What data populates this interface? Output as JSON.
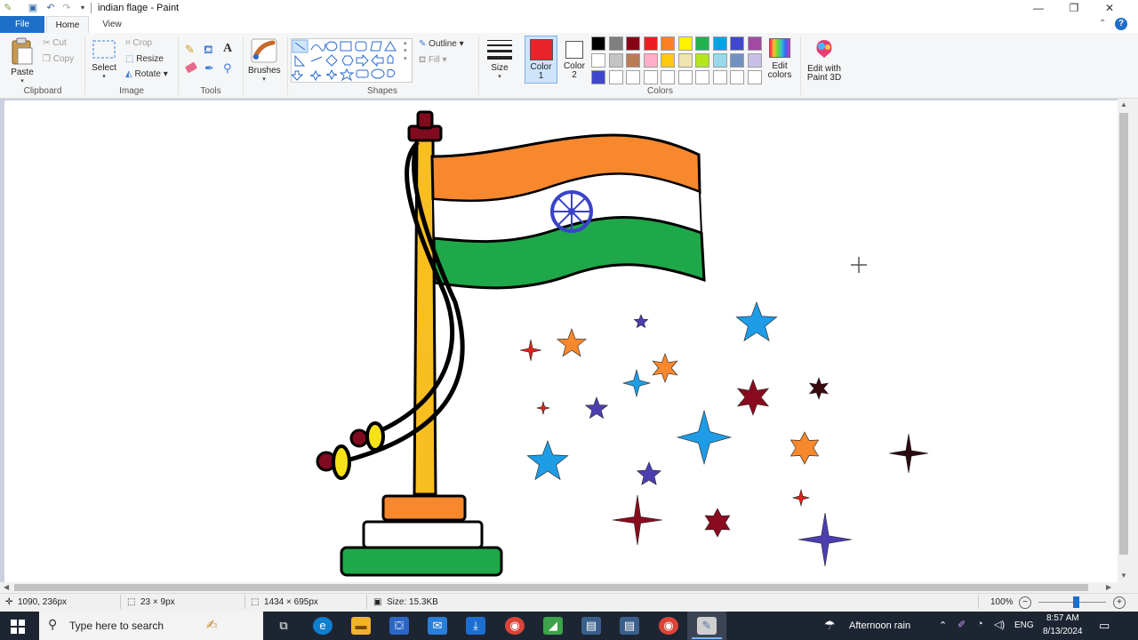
{
  "window": {
    "title": "indian flage - Paint",
    "minimize_glyph": "—",
    "restore_glyph": "❐",
    "close_glyph": "✕",
    "collapse_ribbon_glyph": "⌃",
    "help_glyph": "?"
  },
  "tabs": {
    "file": "File",
    "home": "Home",
    "view": "View"
  },
  "ribbon": {
    "clipboard": {
      "paste": "Paste",
      "cut": "Cut",
      "copy": "Copy",
      "group": "Clipboard"
    },
    "image": {
      "select": "Select",
      "crop": "Crop",
      "resize": "Resize",
      "rotate": "Rotate",
      "group": "Image"
    },
    "tools": {
      "group": "Tools"
    },
    "brushes": {
      "label": "Brushes"
    },
    "shapes": {
      "outline": "Outline",
      "fill": "Fill",
      "group": "Shapes"
    },
    "size": {
      "label": "Size"
    },
    "color1": {
      "label": "Color",
      "num": "1",
      "value": "#e8242a"
    },
    "color2": {
      "label": "Color",
      "num": "2",
      "value": "#ffffff"
    },
    "colors": {
      "group": "Colors"
    },
    "edit_colors": {
      "line1": "Edit",
      "line2": "colors"
    },
    "paint3d": {
      "line1": "Edit with",
      "line2": "Paint 3D"
    },
    "palette": {
      "row1": [
        "#000000",
        "#7f7f7f",
        "#880015",
        "#ed1c24",
        "#ff7f27",
        "#fff200",
        "#22b14c",
        "#00a2e8",
        "#3f48cc",
        "#a349a4"
      ],
      "row2": [
        "#ffffff",
        "#c3c3c3",
        "#b97a57",
        "#ffaec9",
        "#ffc90e",
        "#efe4b0",
        "#b5e61d",
        "#99d9ea",
        "#7092be",
        "#c8bfe7"
      ],
      "row3": [
        "#3f48cc",
        "#ffffff",
        "#ffffff",
        "#ffffff",
        "#ffffff",
        "#ffffff",
        "#ffffff",
        "#ffffff",
        "#ffffff",
        "#ffffff"
      ]
    }
  },
  "status": {
    "cursor_pos": "1090, 236px",
    "selection_size": "23 × 9px",
    "image_size": "1434 × 695px",
    "file_size": "Size: 15.3KB",
    "zoom": "100%",
    "zoom_level": 0.55
  },
  "taskbar": {
    "search_placeholder": "Type here to search",
    "weather": "Afternoon rain",
    "lang": "ENG",
    "time": "8:57 AM",
    "date": "8/13/2024"
  }
}
